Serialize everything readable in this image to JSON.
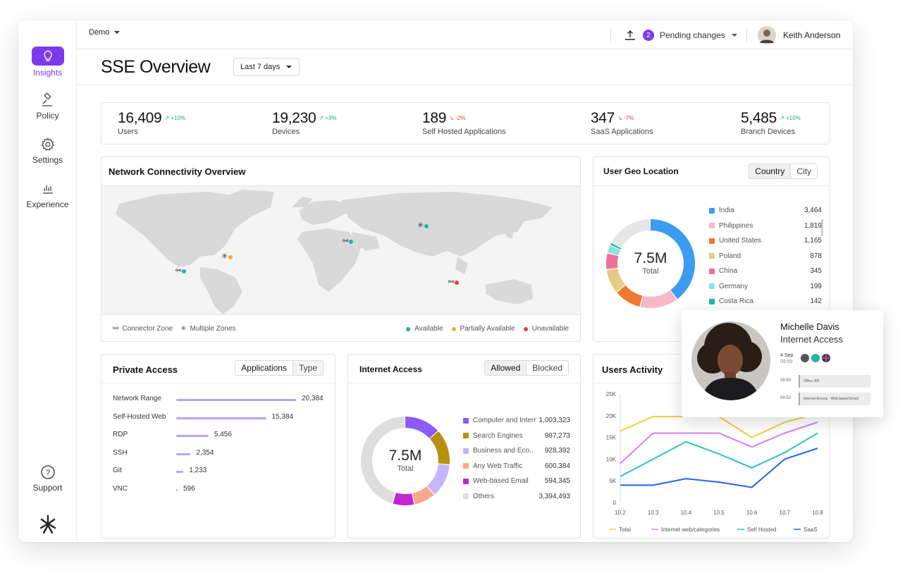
{
  "sidebar": {
    "items": [
      {
        "label": "Insights",
        "icon": "lightbulb-icon"
      },
      {
        "label": "Policy",
        "icon": "gavel-icon"
      },
      {
        "label": "Settings",
        "icon": "gear-icon"
      },
      {
        "label": "Experience",
        "icon": "bar-chart-icon"
      }
    ],
    "support_label": "Support",
    "logo": "app-logo"
  },
  "topbar": {
    "workspace": "Demo",
    "pending_count": "2",
    "pending_label": "Pending changes",
    "user_name": "Keith Anderson"
  },
  "header": {
    "title": "SSE Overview",
    "range": "Last 7 days"
  },
  "stats": [
    {
      "value": "16,409",
      "change": "+10%",
      "dir": "up",
      "label": "Users"
    },
    {
      "value": "19,230",
      "change": "+3%",
      "dir": "up",
      "label": "Devices"
    },
    {
      "value": "189",
      "change": "-2%",
      "dir": "down",
      "label": "Self Hosted Applications"
    },
    {
      "value": "347",
      "change": "-7%",
      "dir": "down",
      "label": "SaaS Applications"
    },
    {
      "value": "5,485",
      "change": "+10%",
      "dir": "up",
      "label": "Branch Devices"
    }
  ],
  "network": {
    "title": "Network Connectivity Overview",
    "legend_connector": "Connector Zone",
    "legend_multiple": "Multiple Zones",
    "status_available": "Available",
    "status_partial": "Partially Available",
    "status_unavailable": "Unavailable"
  },
  "geo": {
    "title": "User Geo Location",
    "tab_country": "Country",
    "tab_city": "City",
    "total_value": "7.5M",
    "total_label": "Total",
    "rows": [
      {
        "name": "India",
        "value": "3,464",
        "color": "#3b9cf2"
      },
      {
        "name": "Philippines",
        "value": "1,819",
        "color": "#f7b7c8"
      },
      {
        "name": "United States",
        "value": "1,165",
        "color": "#f0782f"
      },
      {
        "name": "Poland",
        "value": "878",
        "color": "#e3cc86"
      },
      {
        "name": "China",
        "value": "345",
        "color": "#ef6f9a"
      },
      {
        "name": "Germany",
        "value": "199",
        "color": "#8fe3d8"
      },
      {
        "name": "Costa Rica",
        "value": "142",
        "color": "#1fb8a0"
      }
    ]
  },
  "private": {
    "title": "Private Access",
    "tab_applications": "Applications",
    "tab_type": "Type",
    "rows": [
      {
        "name": "Network Range",
        "value": "20,384",
        "ratio": 1.0
      },
      {
        "name": "Self-Hosted Web",
        "value": "15,384",
        "ratio": 0.75
      },
      {
        "name": "RDP",
        "value": "5,456",
        "ratio": 0.27
      },
      {
        "name": "SSH",
        "value": "2,354",
        "ratio": 0.12
      },
      {
        "name": "Git",
        "value": "1,233",
        "ratio": 0.06
      },
      {
        "name": "VNC",
        "value": "596",
        "ratio": 0.01
      }
    ]
  },
  "internet": {
    "title": "Internet Access",
    "tab_allowed": "Allowed",
    "tab_blocked": "Blocked",
    "total_value": "7.5M",
    "total_label": "Total",
    "rows": [
      {
        "name": "Computer and Intern..",
        "value": "1,003,323",
        "color": "#8b5cf6"
      },
      {
        "name": "Search Engines",
        "value": "987,273",
        "color": "#b8900e"
      },
      {
        "name": "Business and Eco..",
        "value": "928,392",
        "color": "#c4b5fd"
      },
      {
        "name": "Any Web Traffic",
        "value": "600,384",
        "color": "#f9a88e"
      },
      {
        "name": "Web-based Email",
        "value": "594,345",
        "color": "#c026d3"
      },
      {
        "name": "Others",
        "value": "3,394,493",
        "color": "#dedede"
      }
    ]
  },
  "activity": {
    "title": "Users Activity"
  },
  "chart_data": {
    "type": "line",
    "x": [
      "10.2",
      "10.3",
      "10.4",
      "10.5",
      "10.6",
      "10.7",
      "10.8"
    ],
    "ylim": [
      0,
      25000
    ],
    "yticks": [
      "0",
      "5K",
      "10K",
      "15K",
      "20K",
      "25K"
    ],
    "series": [
      {
        "name": "Total",
        "color": "#e6d43c",
        "values": [
          16500,
          19800,
          19800,
          19800,
          15000,
          18500,
          20500
        ]
      },
      {
        "name": "Internet web/categories",
        "color": "#d77ef0",
        "values": [
          9000,
          16000,
          16000,
          16000,
          12800,
          16000,
          18500
        ]
      },
      {
        "name": "Self Hosted",
        "color": "#2ec4b6",
        "values": [
          6000,
          10000,
          14000,
          11200,
          8000,
          11500,
          16000
        ]
      },
      {
        "name": "SaaS",
        "color": "#2563eb",
        "values": [
          4000,
          4000,
          5500,
          4700,
          3500,
          10000,
          12500
        ]
      }
    ]
  },
  "popup": {
    "name": "Michelle Davis",
    "subtitle": "Internet Access",
    "date": "4 Sep",
    "time0": "09:50",
    "time1": "09:50",
    "event1": "Office 365",
    "time2": "09:53",
    "event2": "Internet Access · Web based Email"
  }
}
